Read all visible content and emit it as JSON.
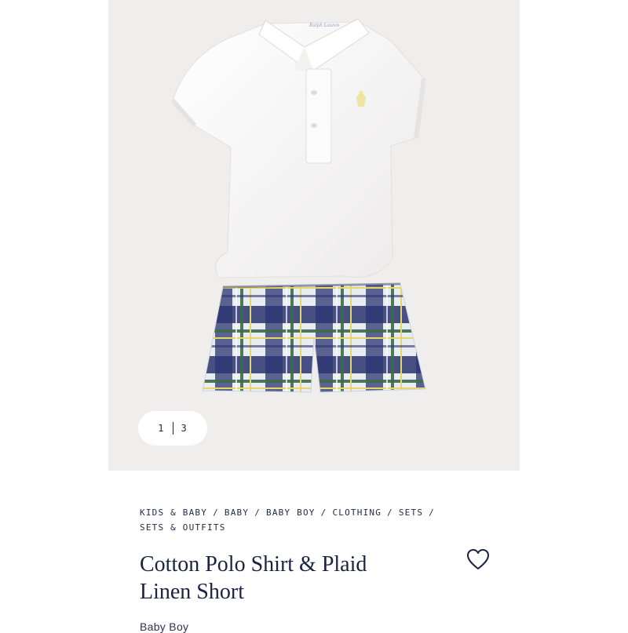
{
  "gallery": {
    "current_index": "1",
    "total": "3",
    "background_color": "#f0eeec"
  },
  "breadcrumb": {
    "items": [
      "KIDS & BABY",
      "BABY",
      "BABY BOY",
      "CLOTHING",
      "SETS",
      "SETS & OUTFITS"
    ],
    "separator": "/"
  },
  "product": {
    "title": "Cotton Polo Shirt & Plaid Linen Short",
    "subtitle": "Baby Boy",
    "collar_label": "Ralph Lauren"
  },
  "icons": {
    "wishlist": "heart-outline-icon"
  },
  "colors": {
    "navy": "#1a2340",
    "plaid_navy": "#2a3470",
    "plaid_green": "#3b6b4a",
    "plaid_yellow": "#e4d66a",
    "logo_yellow": "#efe5a0"
  }
}
